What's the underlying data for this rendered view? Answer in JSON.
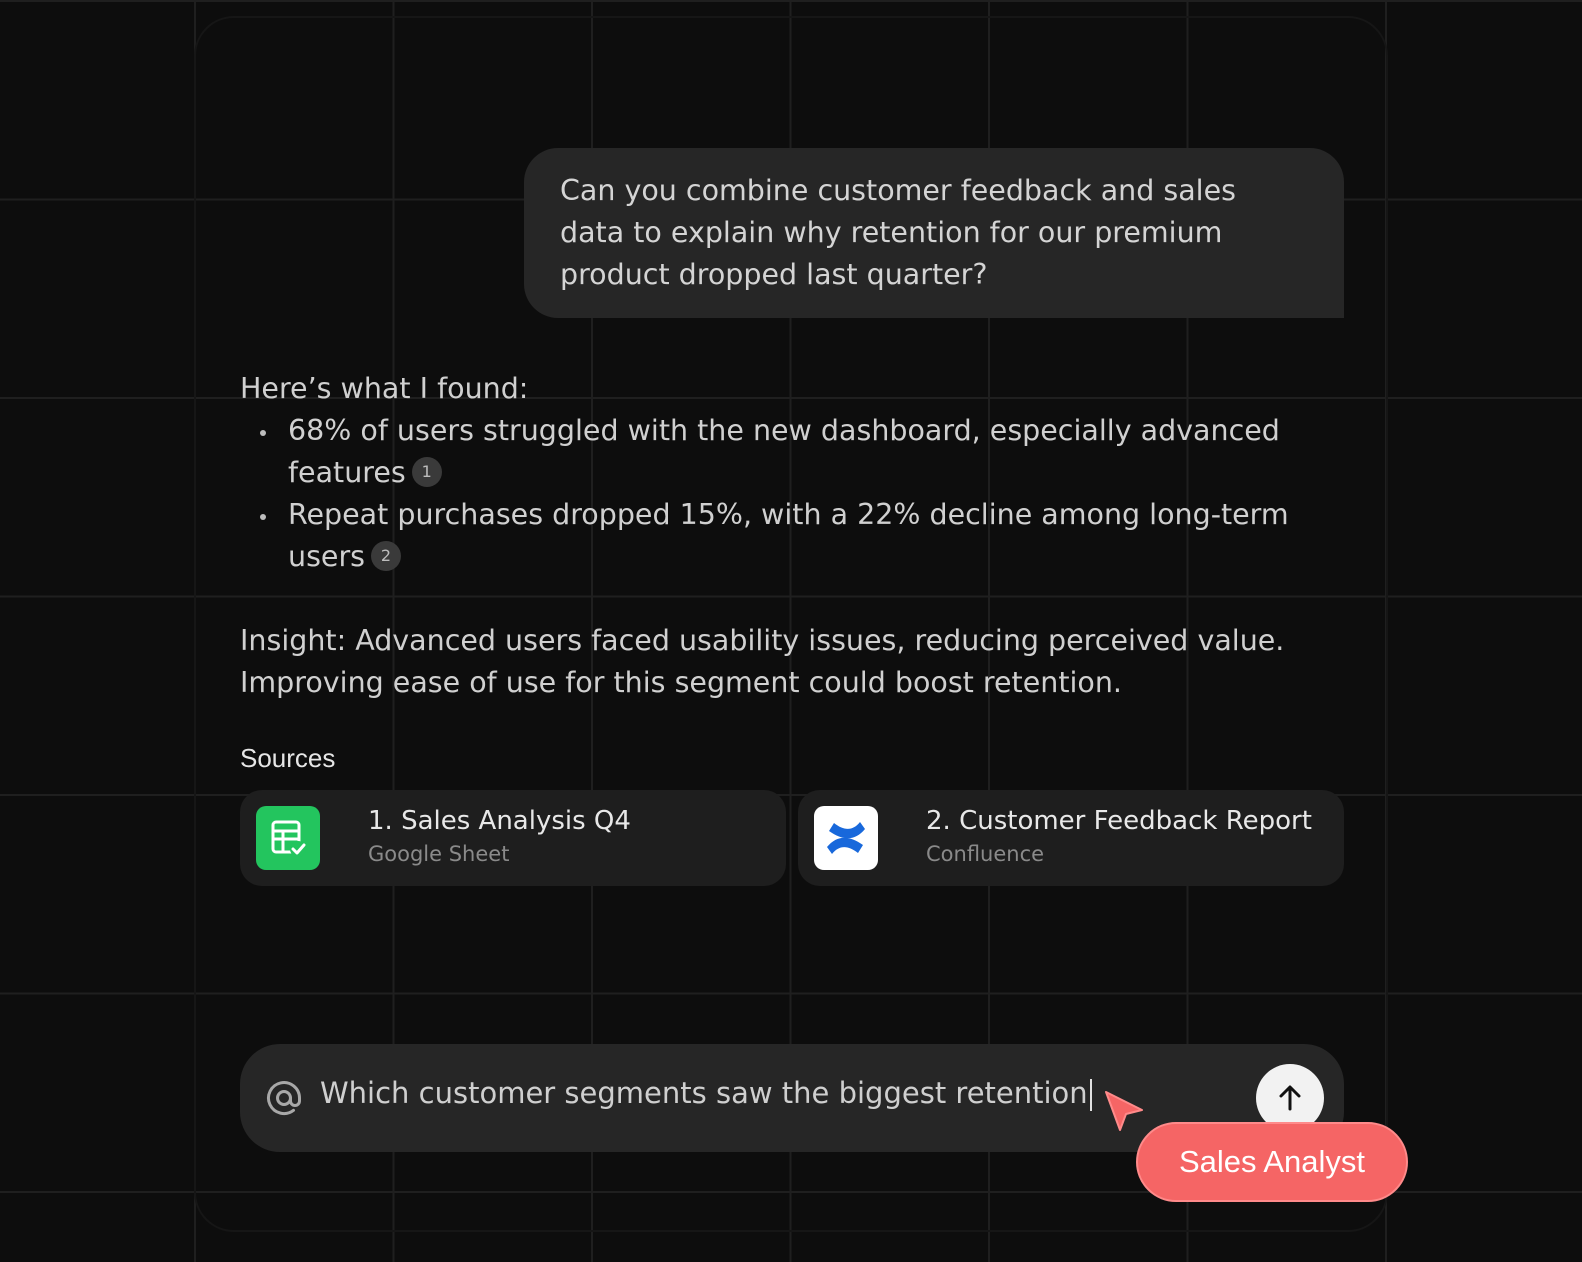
{
  "conversation": {
    "user_message": "Can you combine customer feedback and sales data to explain why retention for our premium product dropped last quarter?",
    "answer_intro": "Here’s what I found:",
    "bullets": [
      {
        "text": "68% of users struggled with the new dashboard, especially advanced features",
        "citation": "1"
      },
      {
        "text": "Repeat purchases dropped 15%, with a 22% decline among long-term users",
        "citation": "2"
      }
    ],
    "insight": "Insight: Advanced users faced usability issues, reducing perceived value. Improving ease of use for this segment could boost retention."
  },
  "sources": {
    "heading": "Sources",
    "items": [
      {
        "title": "1. Sales Analysis Q4",
        "subtitle": "Google Sheet",
        "icon": "google-sheets-icon",
        "color": "#23c55e"
      },
      {
        "title": "2. Customer Feedback Report",
        "subtitle": "Confluence",
        "icon": "confluence-icon",
        "color": "#1868db"
      }
    ]
  },
  "composer": {
    "input_value": "Which customer segments saw the biggest retention",
    "mention_icon": "at-icon",
    "send_icon": "arrow-up-icon"
  },
  "collaborator": {
    "label": "Sales Analyst",
    "color": "#f56565",
    "cursor_icon": "pointer-cursor-icon"
  }
}
